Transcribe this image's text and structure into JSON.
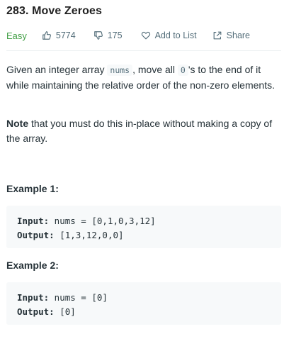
{
  "problem": {
    "title": "283. Move Zeroes",
    "difficulty": "Easy",
    "likes": "5774",
    "dislikes": "175",
    "add_to_list_label": "Add to List",
    "share_label": "Share"
  },
  "description": {
    "p1_a": "Given an integer array ",
    "p1_code1": "nums",
    "p1_b": ", move all ",
    "p1_code2": "0",
    "p1_c": "'s to the end of it while maintaining the relative order of the non-zero elements.",
    "p2_bold": "Note",
    "p2_rest": " that you must do this in-place without making a copy of the array."
  },
  "examples": [
    {
      "heading": "Example 1:",
      "input_label": "Input:",
      "input_value": " nums = [0,1,0,3,12]",
      "output_label": "Output:",
      "output_value": " [1,3,12,0,0]"
    },
    {
      "heading": "Example 2:",
      "input_label": "Input:",
      "input_value": " nums = [0]",
      "output_label": "Output:",
      "output_value": " [0]"
    }
  ],
  "colors": {
    "difficulty_easy": "#43a047",
    "meta_text": "#546e7a",
    "code_bg": "#f7f9fa"
  },
  "icons": {
    "likes": "thumbs-up-icon",
    "dislikes": "thumbs-down-icon",
    "add_to_list": "heart-icon",
    "share": "share-icon"
  }
}
